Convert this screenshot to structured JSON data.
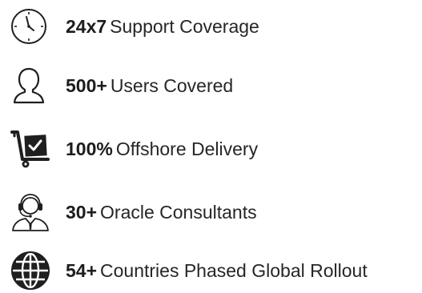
{
  "stats": [
    {
      "value": "24x7",
      "label": "Support Coverage",
      "icon": "clock-icon"
    },
    {
      "value": "500+",
      "label": "Users Covered",
      "icon": "user-icon"
    },
    {
      "value": "100%",
      "label": "Offshore Delivery",
      "icon": "hand-truck-box-icon"
    },
    {
      "value": "30+",
      "label": "Oracle Consultants",
      "icon": "support-agent-headset-icon"
    },
    {
      "value": "54+",
      "label": "Countries Phased Global Rollout",
      "icon": "globe-icon"
    }
  ],
  "colors": {
    "icon_stroke": "#1f1f1f",
    "text": "#262626"
  }
}
